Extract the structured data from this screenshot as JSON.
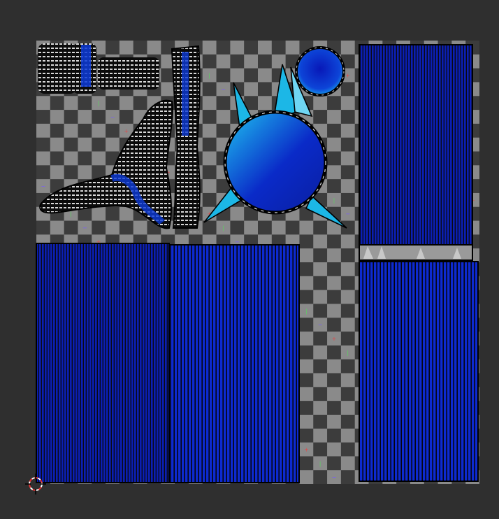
{
  "editor": {
    "view": "uv-editor",
    "background_color": "#2f2f2f"
  },
  "checker": {
    "light_color": "#8a8a8a",
    "dark_color": "#3c3c3c",
    "marker_colors": [
      "#e04a4a",
      "#e0c34a",
      "#58d35e",
      "#4ac9d3",
      "#7a5cff",
      "#ff66cc"
    ]
  },
  "uv_colors": {
    "island_fill_dark": "#0a1f9e",
    "island_fill_light": "#1ec4f0",
    "edge_color": "#000000",
    "edge_highlight": "#d6d6d6",
    "stripe_color": "#0d2bd8",
    "stripe_gap": "#111111"
  },
  "icons": {
    "cursor": "2d-cursor-icon"
  }
}
